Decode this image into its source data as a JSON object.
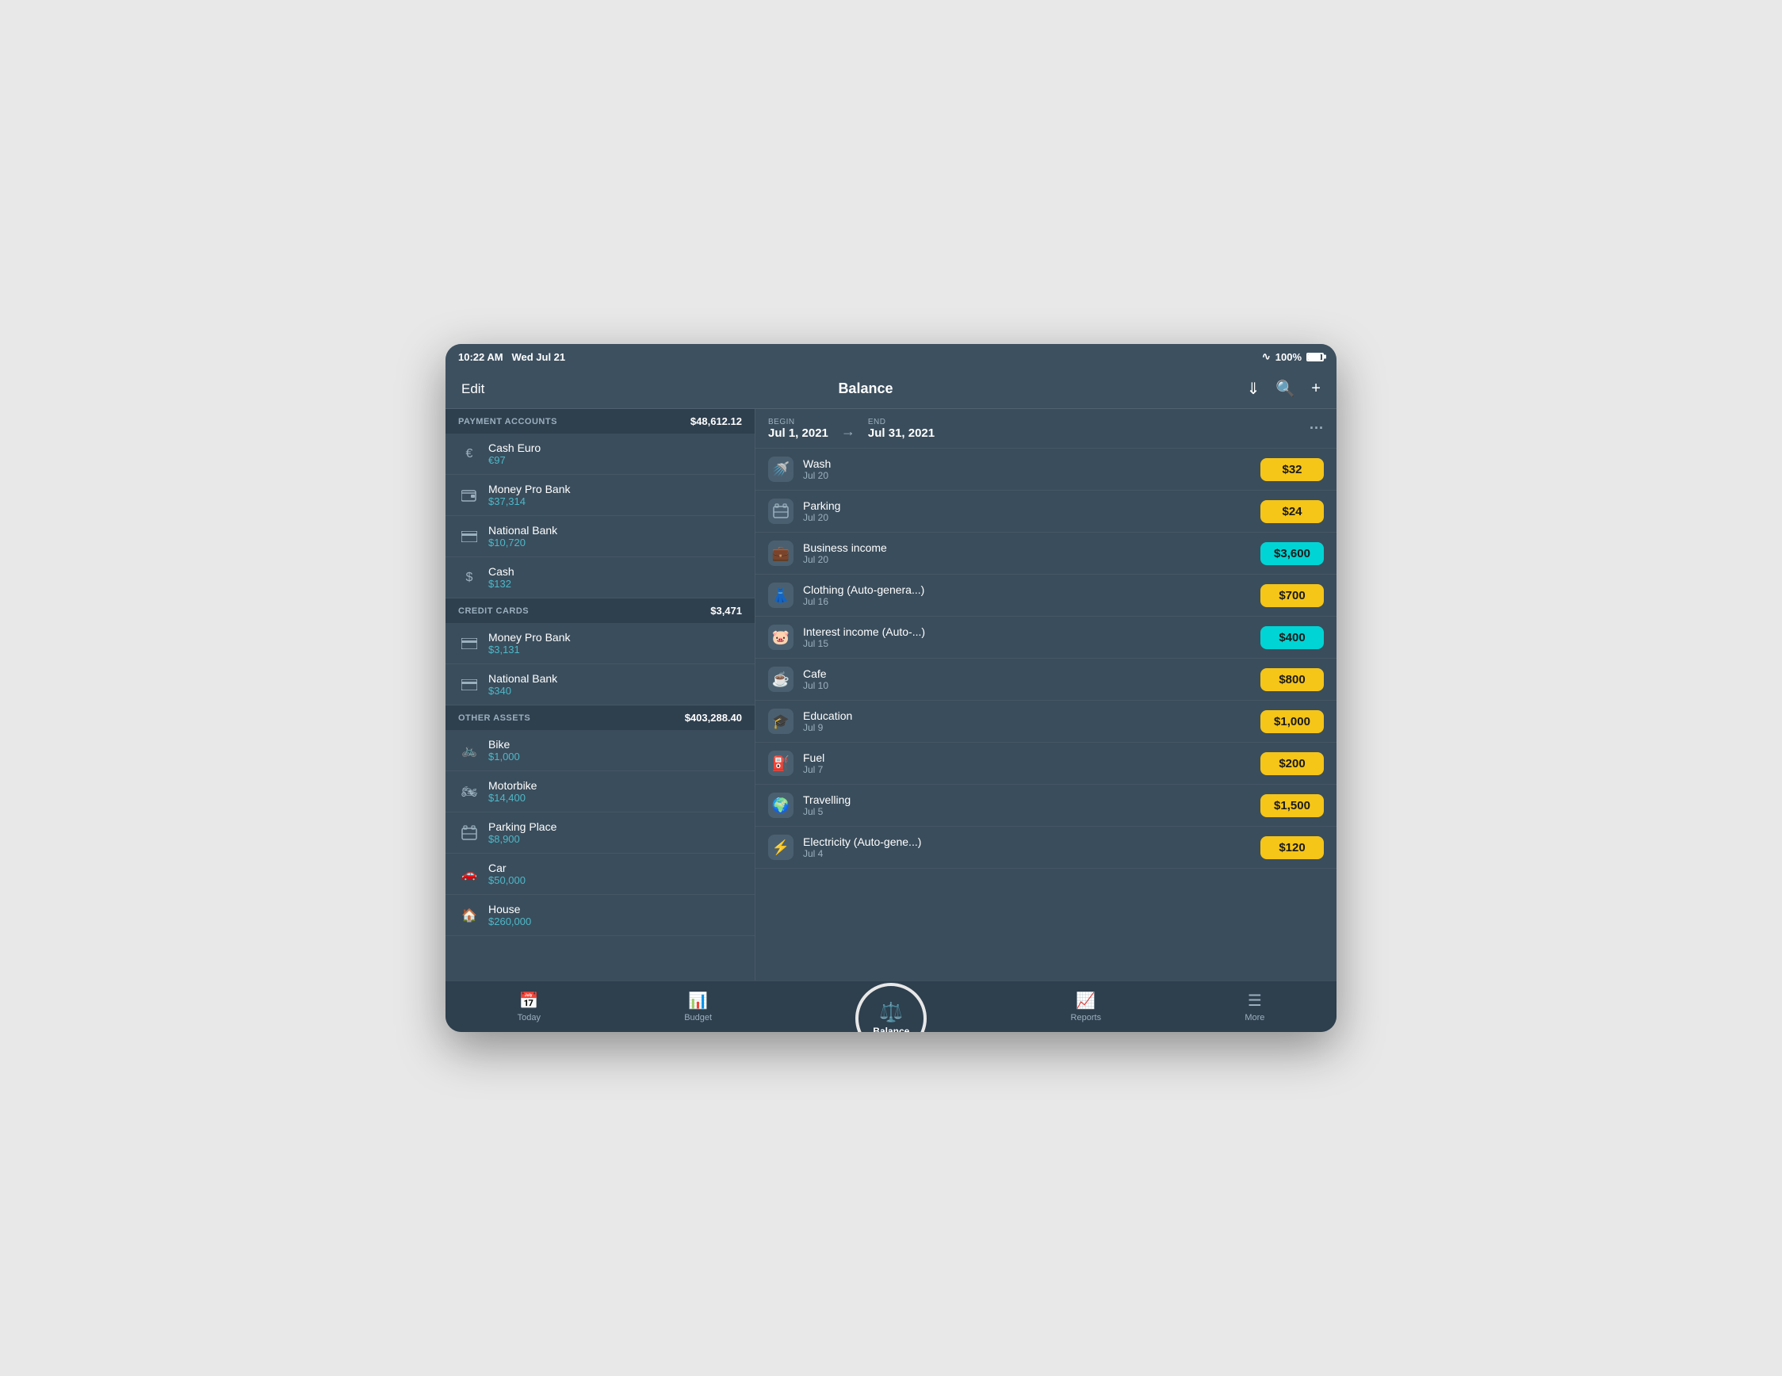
{
  "statusBar": {
    "time": "10:22 AM",
    "date": "Wed Jul 21",
    "battery": "100%",
    "wifiIcon": "wifi"
  },
  "header": {
    "editLabel": "Edit",
    "title": "Balance",
    "downloadIcon": "⬇",
    "searchIcon": "🔍",
    "addIcon": "+"
  },
  "leftPanel": {
    "sections": [
      {
        "title": "PAYMENT ACCOUNTS",
        "total": "$48,612.12",
        "accounts": [
          {
            "icon": "€",
            "name": "Cash Euro",
            "balance": "€97"
          },
          {
            "icon": "💳",
            "name": "Money Pro Bank",
            "balance": "$37,314"
          },
          {
            "icon": "🏦",
            "name": "National Bank",
            "balance": "$10,720"
          },
          {
            "icon": "$",
            "name": "Cash",
            "balance": "$132"
          }
        ]
      },
      {
        "title": "CREDIT CARDS",
        "total": "$3,471",
        "accounts": [
          {
            "icon": "💳",
            "name": "Money Pro Bank",
            "balance": "$3,131"
          },
          {
            "icon": "💳",
            "name": "National Bank",
            "balance": "$340"
          }
        ]
      },
      {
        "title": "OTHER ASSETS",
        "total": "$403,288.40",
        "accounts": [
          {
            "icon": "🚲",
            "name": "Bike",
            "balance": "$1,000"
          },
          {
            "icon": "🏍",
            "name": "Motorbike",
            "balance": "$14,400"
          },
          {
            "icon": "🅿",
            "name": "Parking Place",
            "balance": "$8,900"
          },
          {
            "icon": "🚗",
            "name": "Car",
            "balance": "$50,000"
          },
          {
            "icon": "🏠",
            "name": "House",
            "balance": "$260,000"
          }
        ]
      }
    ]
  },
  "rightPanel": {
    "dateRange": {
      "beginLabel": "Begin",
      "beginValue": "Jul 1, 2021",
      "endLabel": "End",
      "endValue": "Jul 31, 2021"
    },
    "transactions": [
      {
        "icon": "🚿",
        "name": "Wash",
        "date": "Jul 20",
        "amount": "$32",
        "type": "yellow"
      },
      {
        "icon": "🅿",
        "name": "Parking",
        "date": "Jul 20",
        "amount": "$24",
        "type": "yellow"
      },
      {
        "icon": "💼",
        "name": "Business income",
        "date": "Jul 20",
        "amount": "$3,600",
        "type": "cyan"
      },
      {
        "icon": "👗",
        "name": "Clothing (Auto-genera...)",
        "date": "Jul 16",
        "amount": "$700",
        "type": "yellow"
      },
      {
        "icon": "🐷",
        "name": "Interest income (Auto-...)",
        "date": "Jul 15",
        "amount": "$400",
        "type": "cyan"
      },
      {
        "icon": "☕",
        "name": "Cafe",
        "date": "Jul 10",
        "amount": "$800",
        "type": "yellow"
      },
      {
        "icon": "🎓",
        "name": "Education",
        "date": "Jul 9",
        "amount": "$1,000",
        "type": "yellow"
      },
      {
        "icon": "⛽",
        "name": "Fuel",
        "date": "Jul 7",
        "amount": "$200",
        "type": "yellow"
      },
      {
        "icon": "🌍",
        "name": "Travelling",
        "date": "Jul 5",
        "amount": "$1,500",
        "type": "yellow"
      },
      {
        "icon": "⚡",
        "name": "Electricity (Auto-gene...)",
        "date": "Jul 4",
        "amount": "$120",
        "type": "yellow"
      }
    ]
  },
  "bottomNav": {
    "items": [
      {
        "icon": "📅",
        "label": "Today"
      },
      {
        "icon": "📊",
        "label": "Budget"
      },
      {
        "icon": "⚖️",
        "label": "Balance"
      },
      {
        "icon": "📈",
        "label": "Reports"
      },
      {
        "icon": "☰",
        "label": "More"
      }
    ]
  }
}
